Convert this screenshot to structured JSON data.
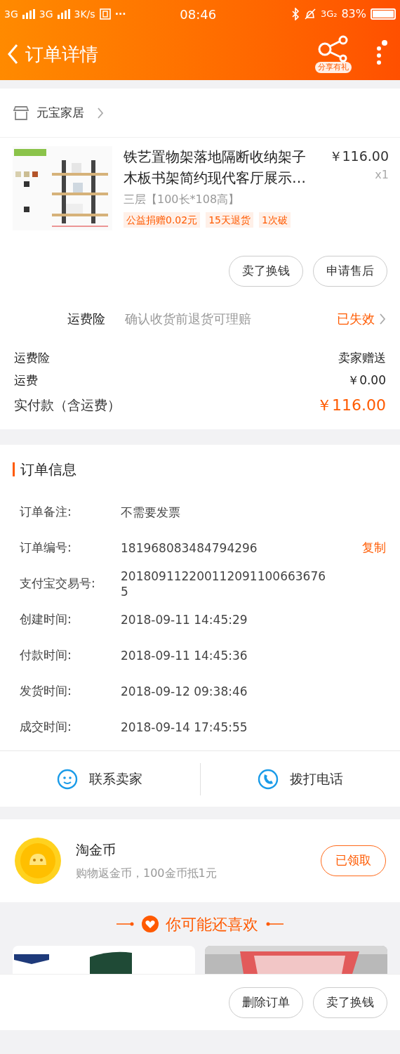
{
  "status_bar": {
    "left": [
      "3G",
      "3G",
      "3K/s"
    ],
    "more": "···",
    "time": "08:46",
    "network": "3G₂",
    "battery": "83%"
  },
  "header": {
    "title": "订单详情",
    "share_label": "分享有礼"
  },
  "shop": {
    "name": "元宝家居"
  },
  "product": {
    "title": "铁艺置物架落地隔断收纳架子木板书架简约现代客厅展示…",
    "price": "￥116.00",
    "quantity": "x1",
    "spec": "三层【100长*108高】",
    "tags": [
      "公益捐赠0.02元",
      "15天退货",
      "1次破"
    ]
  },
  "item_actions": [
    "卖了换钱",
    "申请售后"
  ],
  "insurance": {
    "label": "运费险",
    "description": "确认收货前退货可理赔",
    "status": "已失效"
  },
  "fees": [
    {
      "label": "运费险",
      "value": "卖家赠送",
      "kind": "plain"
    },
    {
      "label": "运费",
      "value": "￥0.00",
      "kind": "plain"
    },
    {
      "label": "实付款（含运费）",
      "value": "￥116.00",
      "kind": "total"
    }
  ],
  "order_info": {
    "title": "订单信息",
    "rows": [
      {
        "label": "订单备注:",
        "value": "不需要发票"
      },
      {
        "label": "订单编号:",
        "value": "181968083484794296",
        "action": "复制"
      },
      {
        "label": "支付宝交易号:",
        "value": "2018091122001120911006636765"
      },
      {
        "label": "创建时间:",
        "value": "2018-09-11 14:45:29"
      },
      {
        "label": "付款时间:",
        "value": "2018-09-11 14:45:36"
      },
      {
        "label": "发货时间:",
        "value": "2018-09-12 09:38:46"
      },
      {
        "label": "成交时间:",
        "value": "2018-09-14 17:45:55"
      }
    ]
  },
  "contact": [
    {
      "label": "联系卖家",
      "kind": "chat"
    },
    {
      "label": "拨打电话",
      "kind": "phone"
    }
  ],
  "coins": {
    "title": "淘金币",
    "subtitle": "购物返金币，100金币抵1元",
    "button": "已领取"
  },
  "recommend": {
    "title": "你可能还喜欢"
  },
  "bottom_actions": [
    "删除订单",
    "卖了换钱"
  ]
}
